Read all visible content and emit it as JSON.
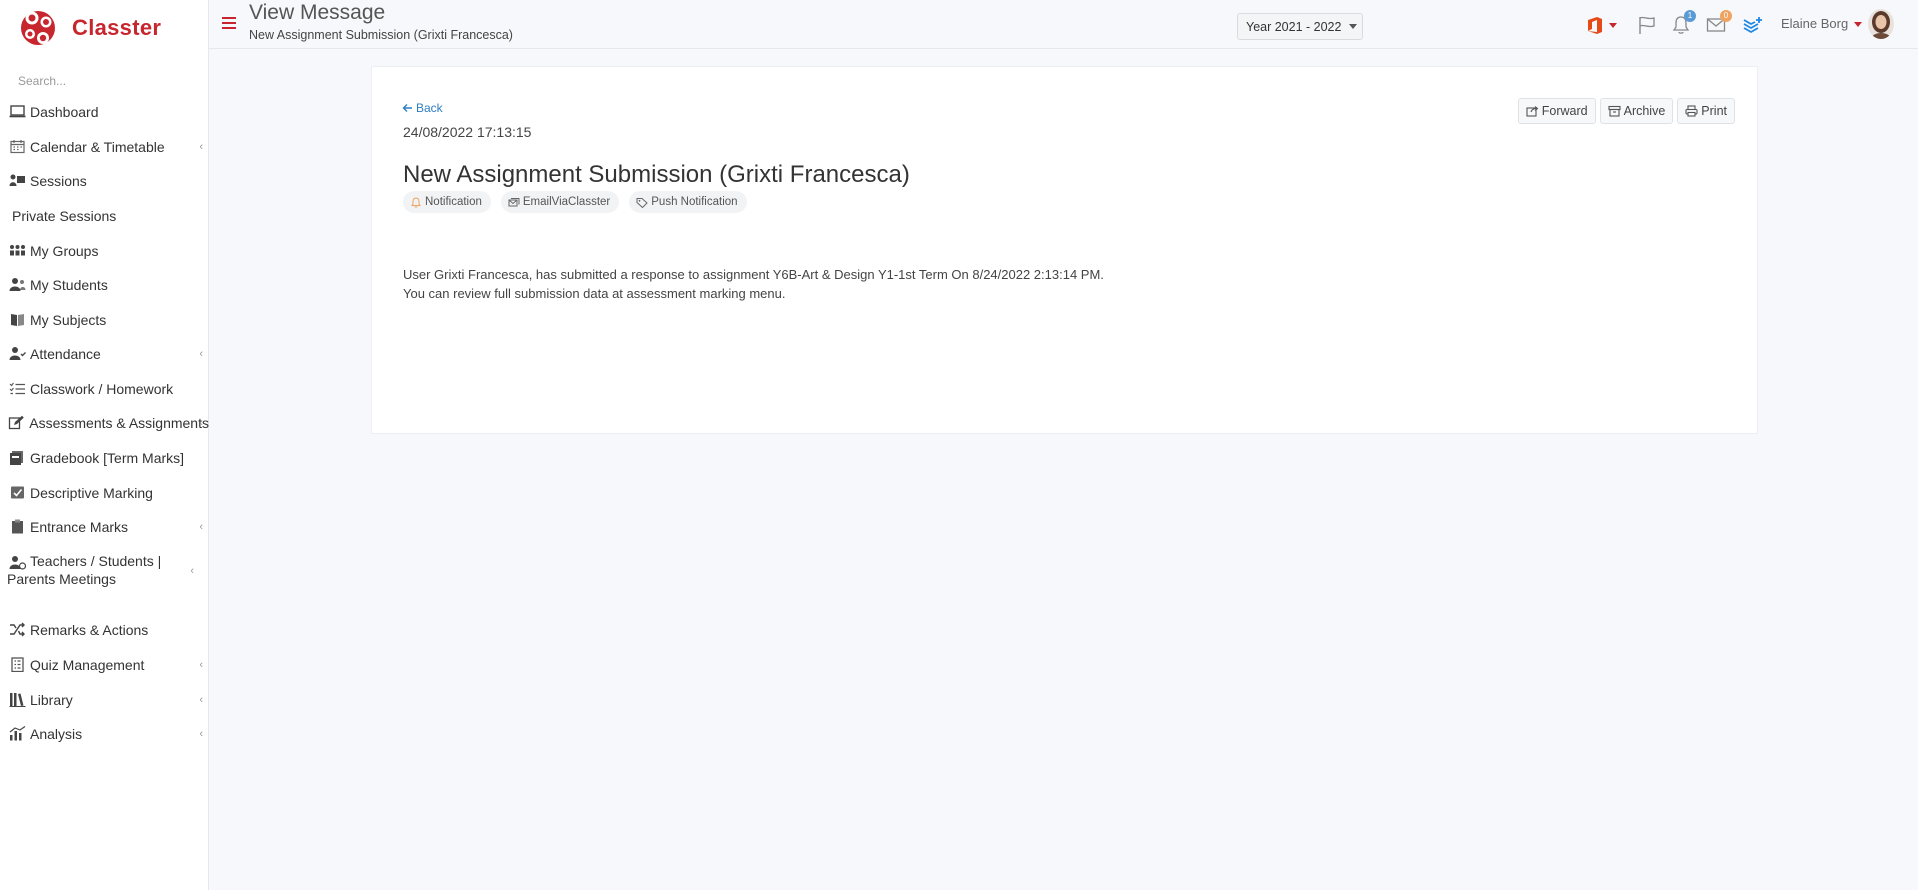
{
  "app": {
    "name": "Classter"
  },
  "sidebar": {
    "search_placeholder": "Search...",
    "items": [
      {
        "label": "Dashboard",
        "icon": "laptop-icon",
        "has_submenu": false
      },
      {
        "label": "Calendar & Timetable",
        "icon": "calendar-icon",
        "has_submenu": true
      },
      {
        "label": "Sessions",
        "icon": "sessions-icon",
        "has_submenu": false
      },
      {
        "label": "Private Sessions",
        "icon": "",
        "has_submenu": false
      },
      {
        "label": "My Groups",
        "icon": "groups-icon",
        "has_submenu": false
      },
      {
        "label": "My Students",
        "icon": "students-icon",
        "has_submenu": false
      },
      {
        "label": "My Subjects",
        "icon": "book-icon",
        "has_submenu": false
      },
      {
        "label": "Attendance",
        "icon": "attendance-icon",
        "has_submenu": true
      },
      {
        "label": "Classwork / Homework",
        "icon": "checklist-icon",
        "has_submenu": false
      },
      {
        "label": "Assessments & Assignments",
        "icon": "edit-icon",
        "has_submenu": true
      },
      {
        "label": "Gradebook [Term Marks]",
        "icon": "gradebook-icon",
        "has_submenu": false
      },
      {
        "label": "Descriptive Marking",
        "icon": "marking-icon",
        "has_submenu": false
      },
      {
        "label": "Entrance Marks",
        "icon": "clipboard-icon",
        "has_submenu": true
      },
      {
        "label": "Teachers / Students | Parents Meetings",
        "icon": "meeting-icon",
        "has_submenu": true
      },
      {
        "label": "Remarks & Actions",
        "icon": "shuffle-icon",
        "has_submenu": false
      },
      {
        "label": "Quiz Management",
        "icon": "quiz-icon",
        "has_submenu": true
      },
      {
        "label": "Library",
        "icon": "library-icon",
        "has_submenu": true
      },
      {
        "label": "Analysis",
        "icon": "analysis-icon",
        "has_submenu": true
      }
    ]
  },
  "header": {
    "title": "View Message",
    "subtitle": "New Assignment Submission (Grixti Francesca)",
    "year": "Year 2021 - 2022",
    "notifications_count": "1",
    "messages_count": "0",
    "user_name": "Elaine Borg"
  },
  "message": {
    "back_label": "Back",
    "date": "24/08/2022 17:13:15",
    "title": "New Assignment Submission (Grixti Francesca)",
    "actions": {
      "forward": "Forward",
      "archive": "Archive",
      "print": "Print"
    },
    "tags": [
      {
        "label": "Notification",
        "icon": "bell-icon"
      },
      {
        "label": "EmailViaClasster",
        "icon": "envelopes-icon"
      },
      {
        "label": "Push Notification",
        "icon": "tag-icon"
      }
    ],
    "body_line1": "User Grixti Francesca, has submitted a response to assignment Y6B-Art & Design Y1-1st Term On 8/24/2022 2:13:14 PM.",
    "body_line2": "You can review full submission data at assessment marking menu."
  },
  "colors": {
    "brand": "#c8262e",
    "link": "#2f7fc1",
    "office": "#e64a19",
    "accent_blue": "#1e88e5"
  }
}
